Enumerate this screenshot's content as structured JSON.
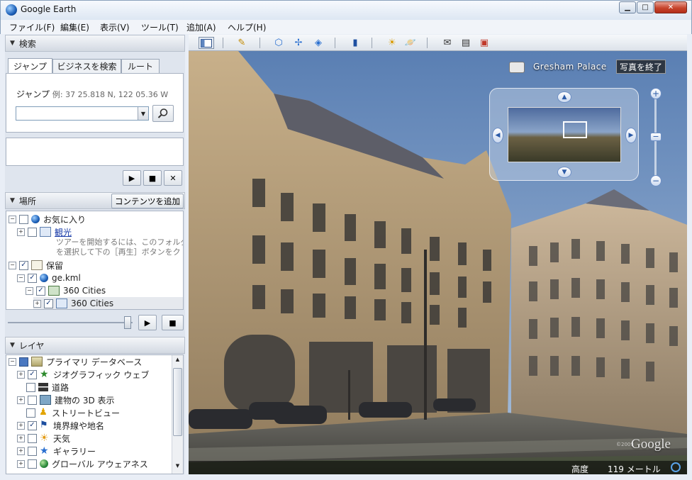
{
  "window": {
    "title": "Google Earth"
  },
  "menu": [
    "ファイル(F)",
    "編集(E)",
    "表示(V)",
    "ツール(T)",
    "追加(A)",
    "ヘルプ(H)"
  ],
  "search": {
    "header": "検索",
    "tabs": [
      "ジャンプ",
      "ビジネスを検索",
      "ルート"
    ],
    "jump_label": "ジャンプ",
    "jump_example": "例: 37 25.818 N, 122 05.36 W",
    "input_value": ""
  },
  "places": {
    "header": "場所",
    "add_content": "コンテンツを追加",
    "favorites": "お気に入り",
    "sightseeing": "観光",
    "tour_note_1": "ツアーを開始するには、このフォルダ",
    "tour_note_2": "を選択して下の［再生］ボタンをク",
    "temporary": "保留",
    "kml": "ge.kml",
    "cities_1": "360 Cities",
    "cities_2": "360 Cities"
  },
  "layers": {
    "header": "レイヤ",
    "items": [
      "プライマリ データベース",
      "ジオグラフィック ウェブ",
      "道路",
      "建物の 3D 表示",
      "ストリートビュー",
      "境界線や地名",
      "天気",
      "ギャラリー",
      "グローバル アウェアネス"
    ]
  },
  "photo": {
    "location": "Gresham Palace",
    "exit_button": "写真を終了"
  },
  "status": {
    "elevation_label": "高度",
    "elevation_value": "119 メートル"
  },
  "watermark": {
    "copyright": "©2009",
    "logo": "Google"
  }
}
